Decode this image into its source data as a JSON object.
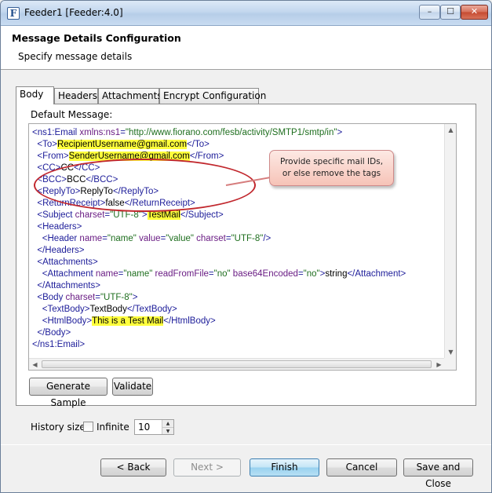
{
  "window": {
    "title": "Feeder1 [Feeder:4.0]",
    "icon_letter": "F",
    "controls": {
      "minimize": "–",
      "maximize": "☐",
      "close": "✕"
    }
  },
  "header": {
    "title": "Message Details Configuration",
    "subtitle": "Specify message details"
  },
  "tabs": [
    {
      "label": "Body",
      "active": true
    },
    {
      "label": "Headers",
      "active": false
    },
    {
      "label": "Attachments",
      "active": false
    },
    {
      "label": "Encrypt Configuration",
      "active": false
    }
  ],
  "body": {
    "group_label": "Default Message:",
    "code_lines": [
      [
        [
          "tag",
          "<ns1:Email "
        ],
        [
          "attr",
          "xmlns:ns1"
        ],
        [
          "tag",
          "="
        ],
        [
          "val",
          "\"http://www.fiorano.com/fesb/activity/SMTP1/smtp/in\""
        ],
        [
          "tag",
          ">"
        ]
      ],
      [
        [
          "text",
          "  "
        ],
        [
          "tag",
          "<To>"
        ],
        [
          "hl",
          "RecipientUsername@gmail.com"
        ],
        [
          "tag",
          "</To>"
        ]
      ],
      [
        [
          "text",
          "  "
        ],
        [
          "tag",
          "<From>"
        ],
        [
          "hl",
          "SenderUsername@gmail.com"
        ],
        [
          "tag",
          "</From>"
        ]
      ],
      [
        [
          "text",
          "  "
        ],
        [
          "tag",
          "<CC>"
        ],
        [
          "text",
          "CC"
        ],
        [
          "tag",
          "</CC>"
        ]
      ],
      [
        [
          "text",
          "  "
        ],
        [
          "tag",
          "<BCC>"
        ],
        [
          "text",
          "BCC"
        ],
        [
          "tag",
          "</BCC>"
        ]
      ],
      [
        [
          "text",
          "  "
        ],
        [
          "tag",
          "<ReplyTo>"
        ],
        [
          "text",
          "ReplyTo"
        ],
        [
          "tag",
          "</ReplyTo>"
        ]
      ],
      [
        [
          "text",
          "  "
        ],
        [
          "tag",
          "<ReturnReceipt>"
        ],
        [
          "text",
          "false"
        ],
        [
          "tag",
          "</ReturnReceipt>"
        ]
      ],
      [
        [
          "text",
          "  "
        ],
        [
          "tag",
          "<Subject "
        ],
        [
          "attr",
          "charset"
        ],
        [
          "tag",
          "="
        ],
        [
          "val",
          "\"UTF-8\""
        ],
        [
          "tag",
          ">"
        ],
        [
          "hl",
          "TestMail"
        ],
        [
          "tag",
          "</Subject>"
        ]
      ],
      [
        [
          "text",
          "  "
        ],
        [
          "tag",
          "<Headers>"
        ]
      ],
      [
        [
          "text",
          "    "
        ],
        [
          "tag",
          "<Header "
        ],
        [
          "attr",
          "name"
        ],
        [
          "tag",
          "="
        ],
        [
          "val",
          "\"name\""
        ],
        [
          "text",
          " "
        ],
        [
          "attr",
          "value"
        ],
        [
          "tag",
          "="
        ],
        [
          "val",
          "\"value\""
        ],
        [
          "text",
          " "
        ],
        [
          "attr",
          "charset"
        ],
        [
          "tag",
          "="
        ],
        [
          "val",
          "\"UTF-8\""
        ],
        [
          "tag",
          "/>"
        ]
      ],
      [
        [
          "text",
          "  "
        ],
        [
          "tag",
          "</Headers>"
        ]
      ],
      [
        [
          "text",
          "  "
        ],
        [
          "tag",
          "<Attachments>"
        ]
      ],
      [
        [
          "text",
          "    "
        ],
        [
          "tag",
          "<Attachment "
        ],
        [
          "attr",
          "name"
        ],
        [
          "tag",
          "="
        ],
        [
          "val",
          "\"name\""
        ],
        [
          "text",
          " "
        ],
        [
          "attr",
          "readFromFile"
        ],
        [
          "tag",
          "="
        ],
        [
          "val",
          "\"no\""
        ],
        [
          "text",
          " "
        ],
        [
          "attr",
          "base64Encoded"
        ],
        [
          "tag",
          "="
        ],
        [
          "val",
          "\"no\""
        ],
        [
          "tag",
          ">"
        ],
        [
          "text",
          "string"
        ],
        [
          "tag",
          "</Attachment>"
        ]
      ],
      [
        [
          "text",
          "  "
        ],
        [
          "tag",
          "</Attachments>"
        ]
      ],
      [
        [
          "text",
          "  "
        ],
        [
          "tag",
          "<Body "
        ],
        [
          "attr",
          "charset"
        ],
        [
          "tag",
          "="
        ],
        [
          "val",
          "\"UTF-8\""
        ],
        [
          "tag",
          ">"
        ]
      ],
      [
        [
          "text",
          "    "
        ],
        [
          "tag",
          "<TextBody>"
        ],
        [
          "text",
          "TextBody"
        ],
        [
          "tag",
          "</TextBody>"
        ]
      ],
      [
        [
          "text",
          "    "
        ],
        [
          "tag",
          "<HtmlBody>"
        ],
        [
          "hl",
          "This is a Test Mail"
        ],
        [
          "tag",
          "</HtmlBody>"
        ]
      ],
      [
        [
          "text",
          "  "
        ],
        [
          "tag",
          "</Body>"
        ]
      ],
      [
        [
          "tag",
          "</ns1:Email>"
        ]
      ]
    ],
    "callout": {
      "line1": "Provide specific mail IDs,",
      "line2": "or else remove the tags"
    },
    "generate_sample_label": "Generate Sample",
    "validate_label": "Validate"
  },
  "history": {
    "label": "History size:",
    "infinite_label": "Infinite",
    "infinite_checked": false,
    "value": "10"
  },
  "footer": {
    "back_label": "< Back",
    "next_label": "Next >",
    "finish_label": "Finish",
    "cancel_label": "Cancel",
    "save_close_label": "Save and Close"
  }
}
